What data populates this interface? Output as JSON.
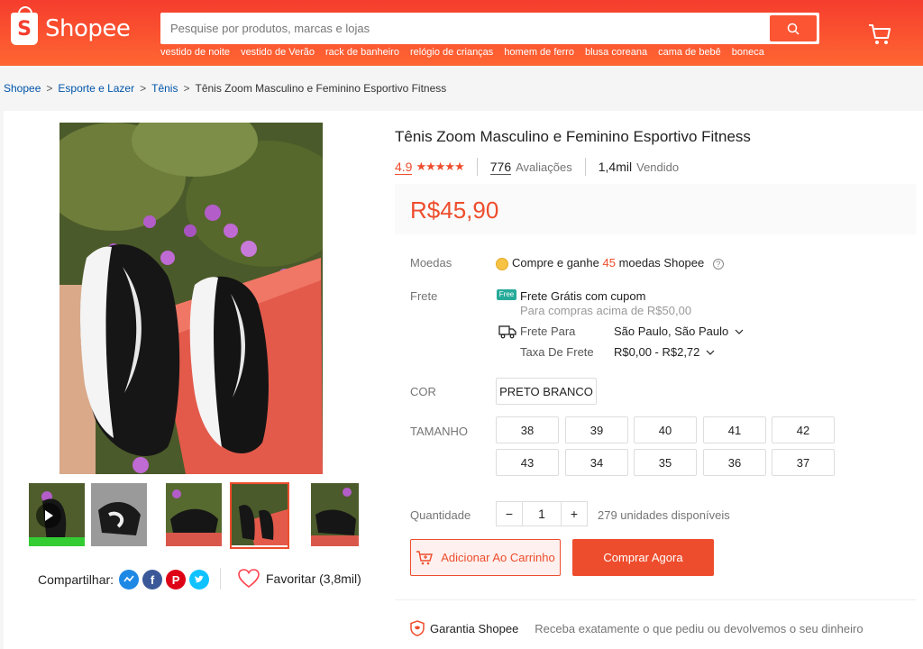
{
  "header": {
    "logo_letter": "S",
    "logo_text": "Shopee",
    "search_placeholder": "Pesquise por produtos, marcas e lojas",
    "suggestions": [
      "vestido de noite",
      "vestido de Verão",
      "rack de banheiro",
      "relógio de crianças",
      "homem de ferro",
      "blusa coreana",
      "cama de bebê",
      "boneca"
    ]
  },
  "breadcrumb": {
    "items": [
      "Shopee",
      "Esporte e Lazer",
      "Tênis"
    ],
    "current": "Tênis Zoom Masculino e Feminino Esportivo Fitness"
  },
  "product": {
    "title": "Tênis Zoom Masculino e Feminino Esportivo Fitness",
    "rating": "4.9",
    "stars": "★★★★★",
    "reviews_count": "776",
    "reviews_label": "Avaliações",
    "sold_count": "1,4mil",
    "sold_label": "Vendido",
    "price": "R$45,90"
  },
  "coins": {
    "label": "Moedas",
    "text_before": "Compre e ganhe",
    "amount": "45",
    "text_after": "moedas Shopee"
  },
  "shipping": {
    "label": "Frete",
    "badge": "Free",
    "free_title": "Frete Grátis com cupom",
    "free_sub": "Para compras acima de R$50,00",
    "to_label": "Frete Para",
    "to_value": "São Paulo, São Paulo",
    "fee_label": "Taxa De Frete",
    "fee_value": "R$0,00 - R$2,72"
  },
  "color": {
    "label": "COR",
    "options": [
      "PRETO BRANCO"
    ]
  },
  "size": {
    "label": "TAMANHO",
    "options": [
      "38",
      "39",
      "40",
      "41",
      "42",
      "43",
      "34",
      "35",
      "36",
      "37"
    ]
  },
  "quantity": {
    "label": "Quantidade",
    "value": "1",
    "minus": "−",
    "plus": "+",
    "available": "279 unidades disponíveis"
  },
  "actions": {
    "add_to_cart": "Adicionar Ao Carrinho",
    "buy_now": "Comprar Agora"
  },
  "share": {
    "label": "Compartilhar:",
    "networks": [
      "messenger-icon",
      "facebook-icon",
      "pinterest-icon",
      "twitter-icon"
    ],
    "facebook_glyph": "f",
    "pinterest_glyph": "P"
  },
  "favorite": {
    "label": "Favoritar (3,8mil)"
  },
  "guarantee": {
    "title": "Garantia Shopee",
    "text": "Receba exatamente o que pediu ou devolvemos o seu dinheiro"
  },
  "colors": {
    "brand": "#ee4d2d",
    "link": "#0055aa"
  }
}
